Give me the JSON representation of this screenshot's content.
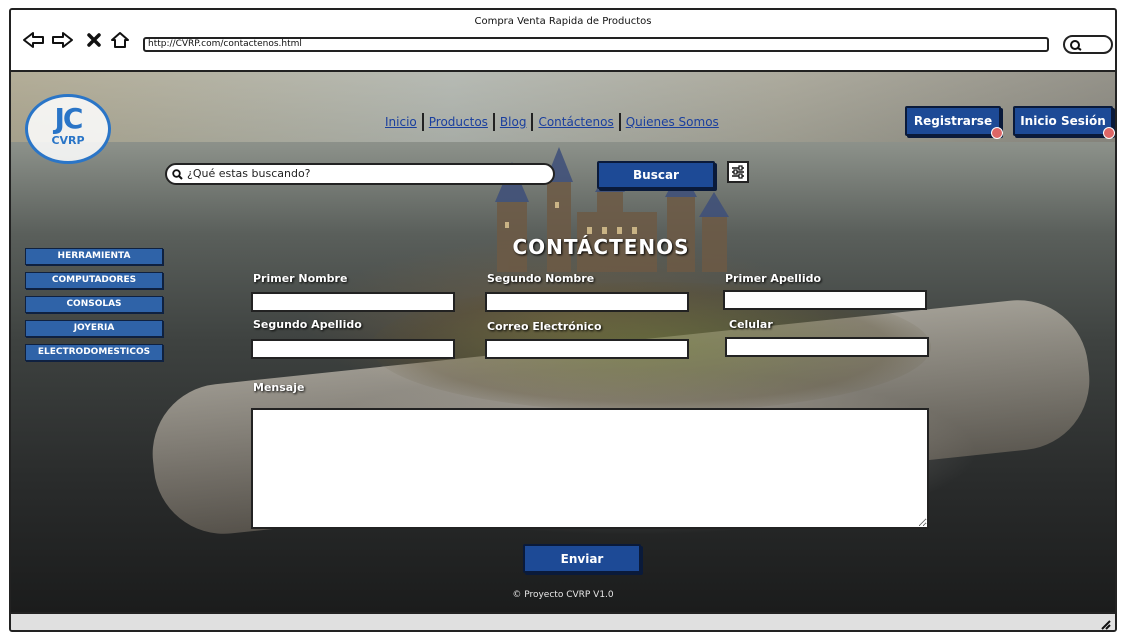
{
  "window": {
    "title": "Compra Venta Rapida de Productos",
    "url": "http://CVRP.com/contactenos.html"
  },
  "logo": {
    "mark": "JC",
    "text": "CVRP"
  },
  "nav": {
    "links": [
      "Inicio",
      "Productos",
      "Blog",
      "Contáctenos",
      "Quienes Somos"
    ]
  },
  "auth": {
    "register_label": "Registrarse",
    "login_label": "Inicio Sesión"
  },
  "search": {
    "placeholder": "¿Qué estas buscando?",
    "button_label": "Buscar"
  },
  "categories": [
    "HERRAMIENTA",
    "COMPUTADORES",
    "CONSOLAS",
    "JOYERIA",
    "ELECTRODOMESTICOS"
  ],
  "form": {
    "title": "CONTÁCTENOS",
    "labels": {
      "first_name": "Primer Nombre",
      "second_name": "Segundo Nombre",
      "first_surname": "Primer Apellido",
      "second_surname": "Segundo Apellido",
      "email": "Correo Electrónico",
      "phone": "Celular",
      "message": "Mensaje"
    },
    "values": {
      "first_name": "",
      "second_name": "",
      "first_surname": "",
      "second_surname": "",
      "email": "",
      "phone": "",
      "message": ""
    },
    "submit_label": "Enviar"
  },
  "footer": {
    "text": "© Proyecto CVRP V1.0"
  },
  "colors": {
    "button_blue": "#1d4a96",
    "category_blue": "#2f63a8",
    "link_blue": "#1a3f9e",
    "logo_blue": "#2a75c7"
  }
}
